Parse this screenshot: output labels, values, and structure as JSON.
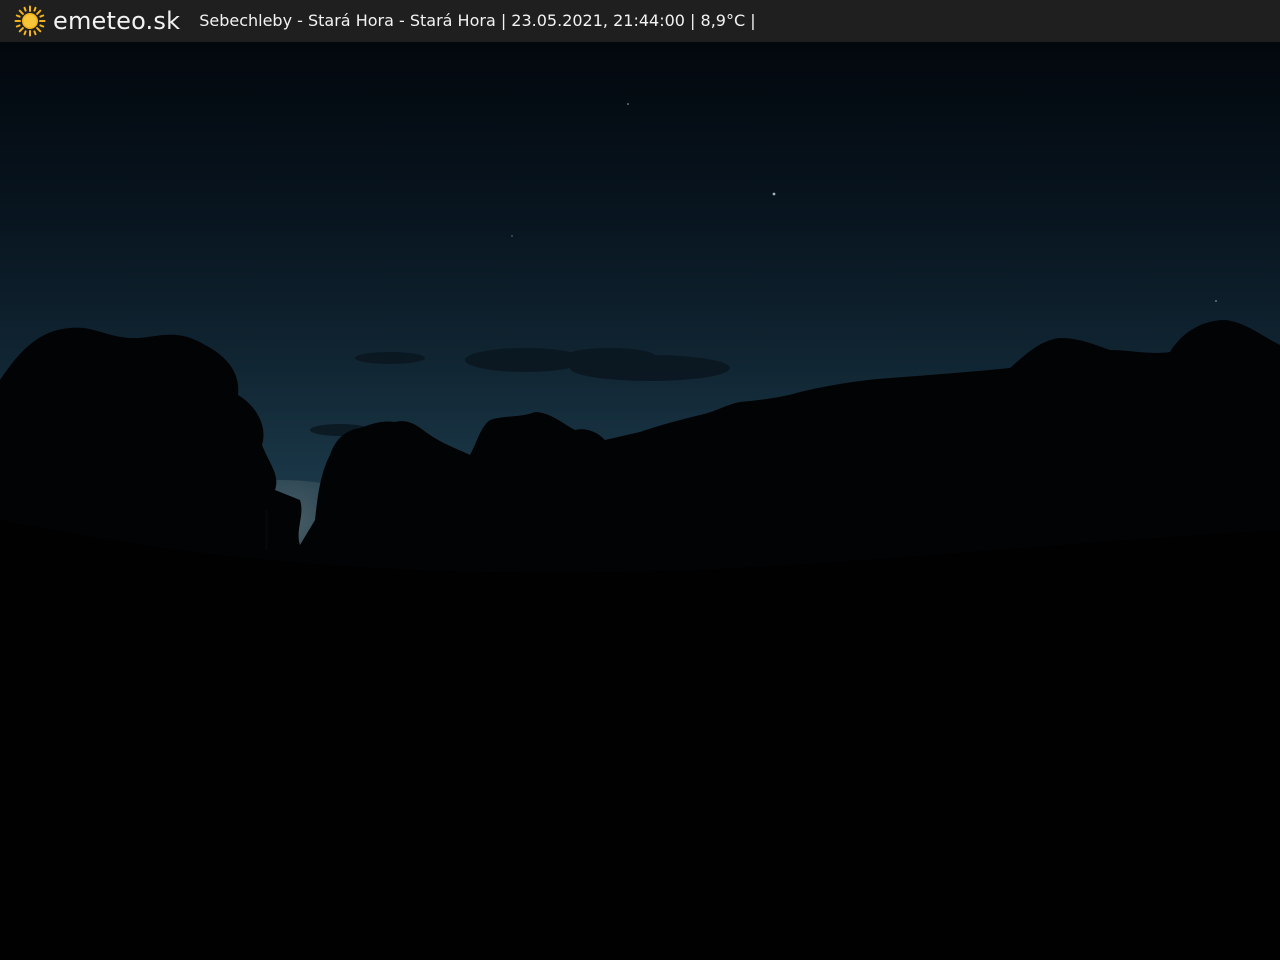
{
  "header": {
    "brand": "emeteo.sk",
    "logo_icon": "sun-icon",
    "caption": "Sebechleby - Stará Hora - Stará Hora | 23.05.2021, 21:44:00 | 8,9°C |"
  },
  "colors": {
    "bar_background": "#1f1f1f",
    "sun": "#f4b41a",
    "sky_top": "#03080d",
    "sky_horizon": "#1a3747",
    "ground": "#020304"
  }
}
